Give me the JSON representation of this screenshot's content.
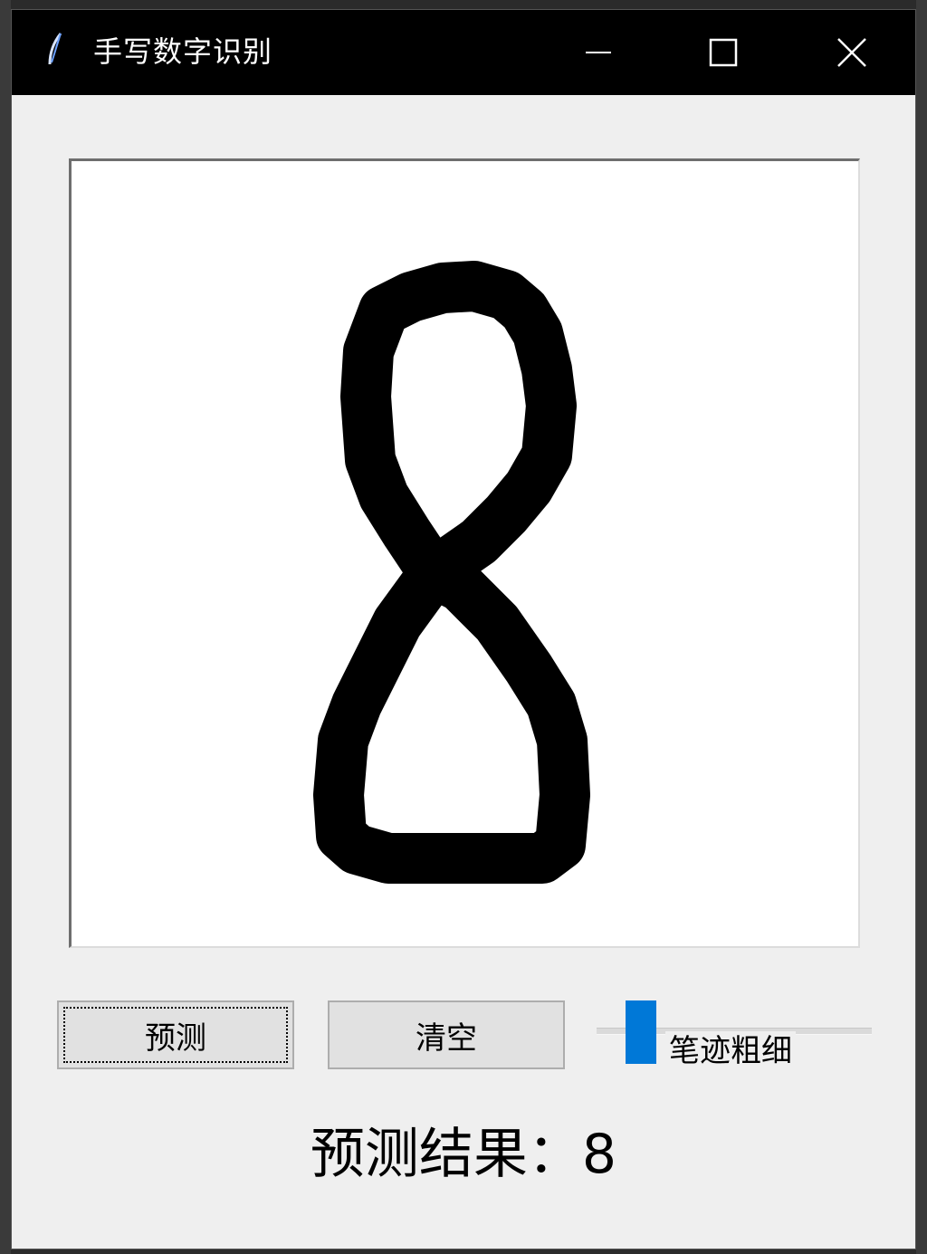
{
  "window": {
    "title": "手写数字识别",
    "controls": [
      "minimize-icon",
      "maximize-icon",
      "close-icon"
    ]
  },
  "canvas": {
    "background": "#ffffff",
    "stroke_color": "#000000",
    "drawn_digit": "8"
  },
  "buttons": {
    "predict_label": "预测",
    "clear_label": "清空"
  },
  "slider": {
    "label": "笔迹粗细",
    "accent_color": "#0078d7"
  },
  "result": {
    "label": "预测结果：",
    "value": "8"
  }
}
